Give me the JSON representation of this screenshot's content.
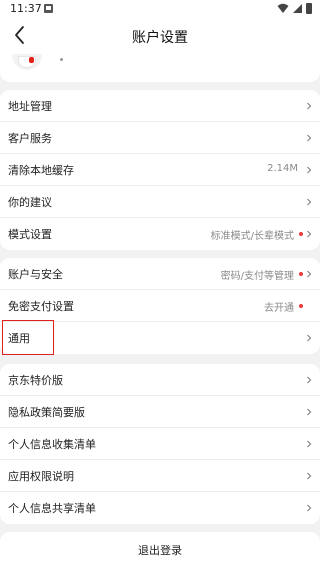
{
  "status_bar": {
    "time": "11:37"
  },
  "header": {
    "title": "账户设置"
  },
  "group1": [
    {
      "label": "地址管理",
      "value": ""
    },
    {
      "label": "客户服务",
      "value": ""
    },
    {
      "label": "清除本地缓存",
      "value": "2.14M"
    },
    {
      "label": "你的建议",
      "value": ""
    },
    {
      "label": "模式设置",
      "value": "标准模式/长辈模式"
    }
  ],
  "group2": [
    {
      "label": "账户与安全",
      "value": "密码/支付等管理"
    },
    {
      "label": "免密支付设置",
      "value": "去开通"
    },
    {
      "label": "通用",
      "value": ""
    }
  ],
  "group3": [
    {
      "label": "京东特价版",
      "value": ""
    },
    {
      "label": "隐私政策简要版",
      "value": ""
    },
    {
      "label": "个人信息收集清单",
      "value": ""
    },
    {
      "label": "应用权限说明",
      "value": ""
    },
    {
      "label": "个人信息共享清单",
      "value": ""
    }
  ],
  "logout": {
    "label": "退出登录"
  },
  "colors": {
    "highlight": "#e0201c",
    "dot": "#e93b3d",
    "background": "#f2f2f2"
  },
  "icons": {
    "back": "back-arrow-icon",
    "chevron": "chevron-right-icon",
    "wifi": "wifi-icon",
    "signal": "signal-icon",
    "battery": "battery-icon",
    "notification": "notification-icon"
  }
}
